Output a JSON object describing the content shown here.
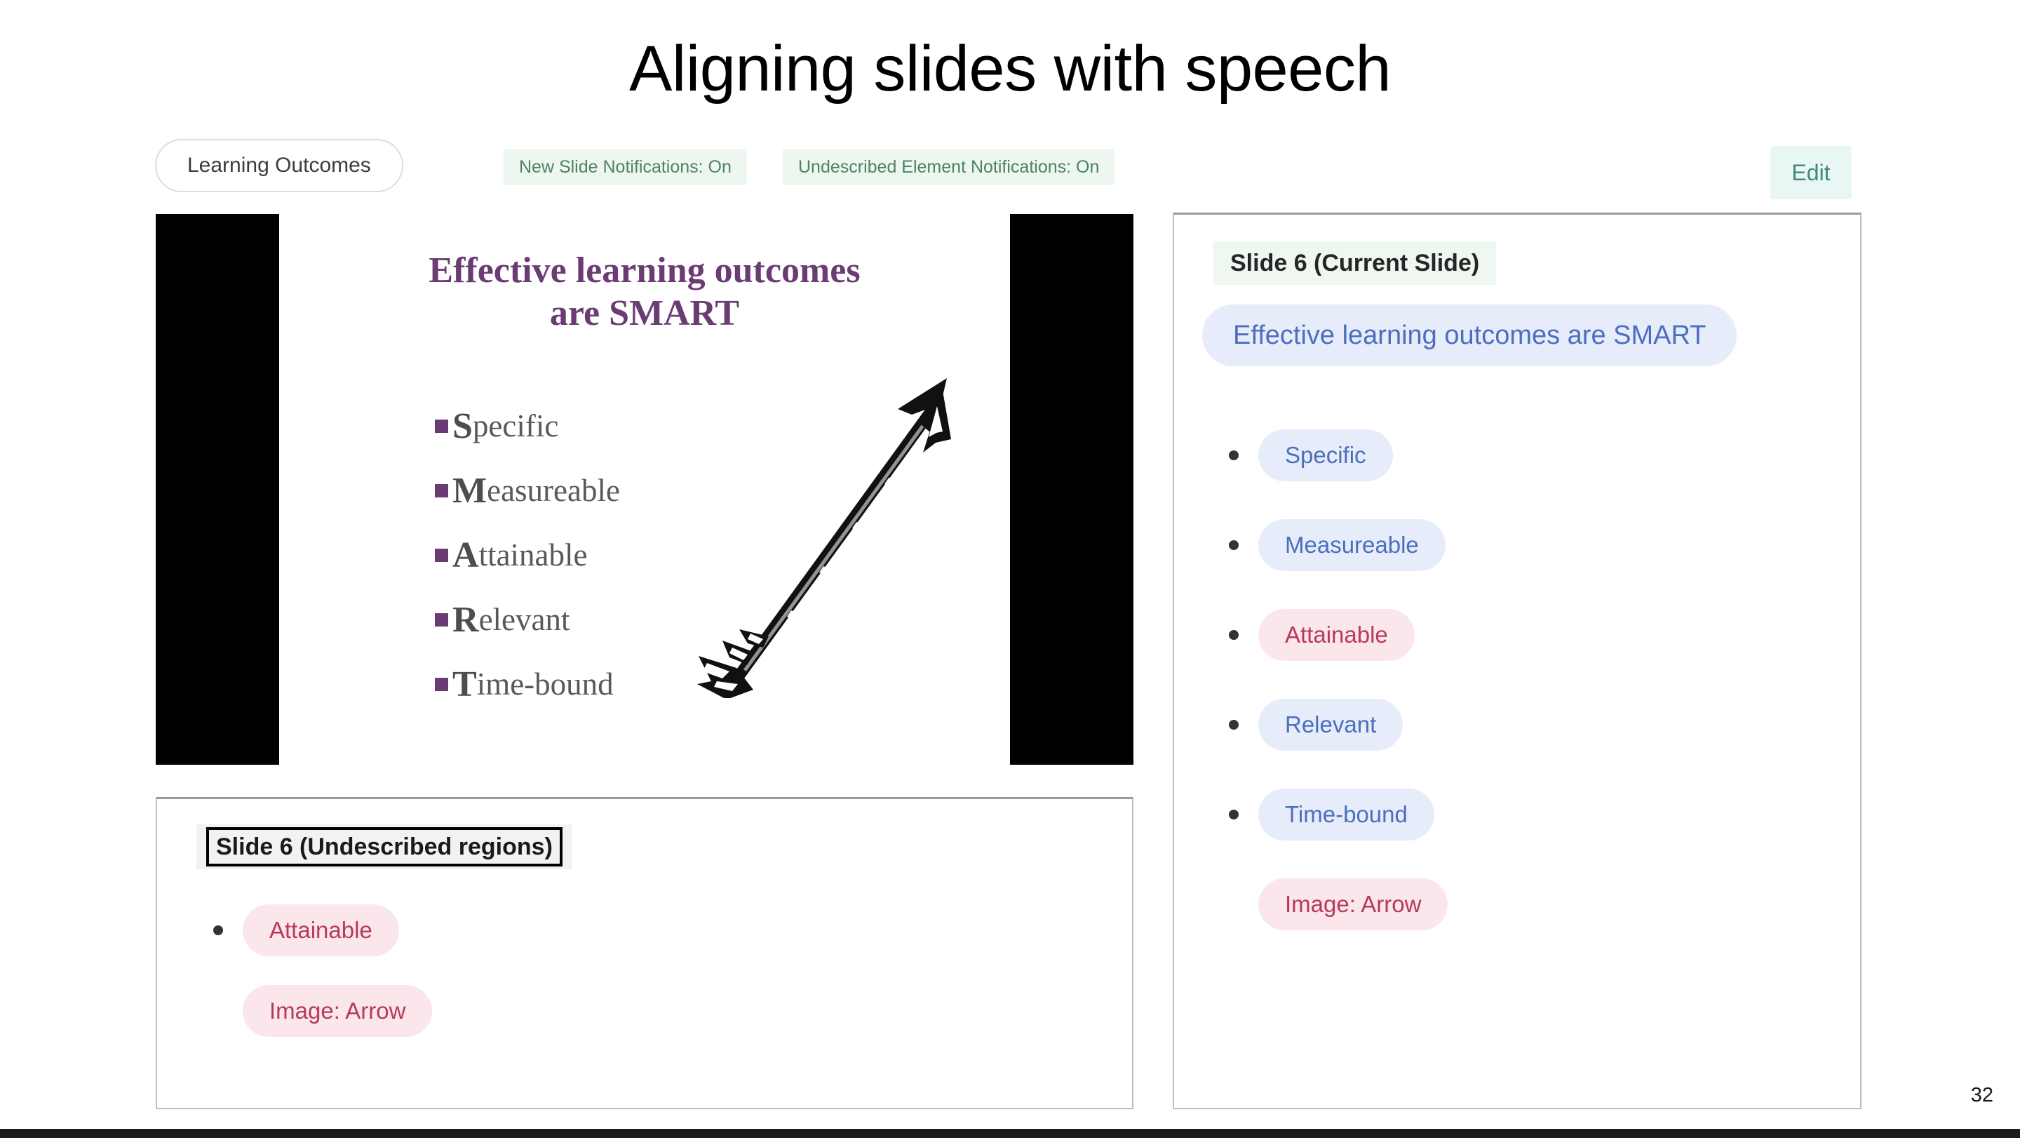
{
  "deck": {
    "title": "Aligning slides with speech",
    "page_number": "32"
  },
  "toolbar": {
    "deck_name": "Learning Outcomes",
    "status_badges": [
      {
        "label": "New Slide Notifications: On"
      },
      {
        "label": "Undescribed Element Notifications: On"
      }
    ],
    "edit_label": "Edit"
  },
  "slide_preview": {
    "heading_line1": "Effective learning outcomes",
    "heading_line2": "are SMART",
    "bullets": [
      {
        "cap": "S",
        "rest": "pecific"
      },
      {
        "cap": "M",
        "rest": "easureable"
      },
      {
        "cap": "A",
        "rest": "ttainable"
      },
      {
        "cap": "R",
        "rest": "elevant"
      },
      {
        "cap": "T",
        "rest": "ime-bound"
      }
    ],
    "image_alt": "arrow"
  },
  "undescribed_panel": {
    "header": "Slide 6 (Undescribed regions)",
    "items": [
      {
        "label": "Attainable",
        "state": "undescribed",
        "bullet": true
      },
      {
        "label": "Image: Arrow",
        "state": "undescribed",
        "bullet": false
      }
    ]
  },
  "current_slide_panel": {
    "header": "Slide 6 (Current Slide)",
    "title_chip": "Effective learning outcomes are SMART",
    "items": [
      {
        "label": "Specific",
        "state": "described",
        "bullet": true
      },
      {
        "label": "Measureable",
        "state": "described",
        "bullet": true
      },
      {
        "label": "Attainable",
        "state": "undescribed",
        "bullet": true
      },
      {
        "label": "Relevant",
        "state": "described",
        "bullet": true
      },
      {
        "label": "Time-bound",
        "state": "described",
        "bullet": true
      },
      {
        "label": "Image: Arrow",
        "state": "undescribed",
        "bullet": false
      }
    ]
  },
  "colors": {
    "described_chip_bg": "#e6ecfa",
    "described_chip_text": "#4b6fbe",
    "undescribed_chip_bg": "#fbe6ec",
    "undescribed_chip_text": "#b83a56",
    "status_badge_bg": "#edf7ef",
    "status_badge_text": "#4d8361",
    "edit_bg": "#e9f7f4",
    "edit_text": "#3f8a7c",
    "slide_heading": "#6b3c74"
  }
}
